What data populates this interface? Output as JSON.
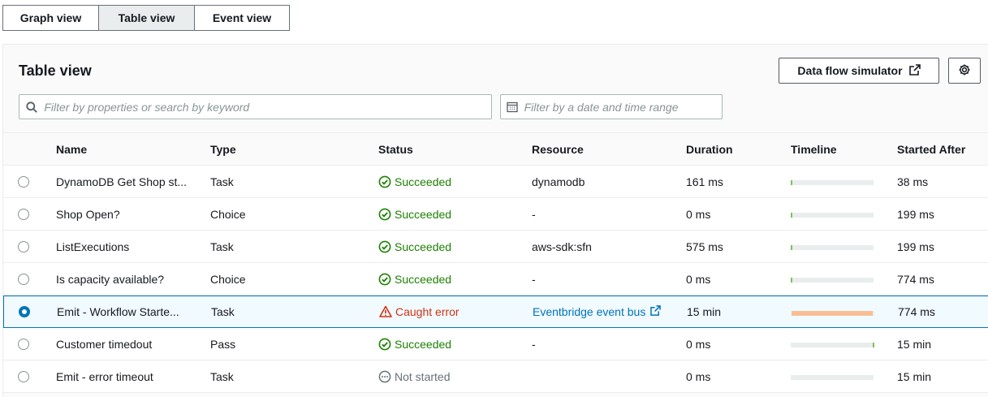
{
  "tabs": [
    {
      "label": "Graph view",
      "active": false
    },
    {
      "label": "Table view",
      "active": true
    },
    {
      "label": "Event view",
      "active": false
    }
  ],
  "panel": {
    "title": "Table view",
    "simulator_label": "Data flow simulator",
    "search_placeholder": "Filter by properties or search by keyword",
    "date_placeholder": "Filter by a date and time range"
  },
  "columns": [
    "Name",
    "Type",
    "Status",
    "Resource",
    "Duration",
    "Timeline",
    "Started After"
  ],
  "rows": [
    {
      "name": "DynamoDB Get Shop st...",
      "type": "Task",
      "status": "Succeeded",
      "status_kind": "ok",
      "resource": "dynamodb",
      "resource_link": false,
      "duration": "161 ms",
      "started_after": "38 ms",
      "selected": false,
      "timeline_start": 0.0,
      "timeline_fill": 0.01
    },
    {
      "name": "Shop Open?",
      "type": "Choice",
      "status": "Succeeded",
      "status_kind": "ok",
      "resource": "-",
      "resource_link": false,
      "duration": "0 ms",
      "started_after": "199 ms",
      "selected": false,
      "timeline_start": 0.0,
      "timeline_fill": 0.01
    },
    {
      "name": "ListExecutions",
      "type": "Task",
      "status": "Succeeded",
      "status_kind": "ok",
      "resource": "aws-sdk:sfn",
      "resource_link": false,
      "duration": "575 ms",
      "started_after": "199 ms",
      "selected": false,
      "timeline_start": 0.0,
      "timeline_fill": 0.01
    },
    {
      "name": "Is capacity available?",
      "type": "Choice",
      "status": "Succeeded",
      "status_kind": "ok",
      "resource": "-",
      "resource_link": false,
      "duration": "0 ms",
      "started_after": "774 ms",
      "selected": false,
      "timeline_start": 0.0,
      "timeline_fill": 0.01
    },
    {
      "name": "Emit - Workflow Starte...",
      "type": "Task",
      "status": "Caught error",
      "status_kind": "err",
      "resource": "Eventbridge event bus",
      "resource_link": true,
      "duration": "15 min",
      "started_after": "774 ms",
      "selected": true,
      "timeline_start": 0.0,
      "timeline_fill": 0.98
    },
    {
      "name": "Customer timedout",
      "type": "Pass",
      "status": "Succeeded",
      "status_kind": "ok",
      "resource": "-",
      "resource_link": false,
      "duration": "0 ms",
      "started_after": "15 min",
      "selected": false,
      "timeline_start": 0.99,
      "timeline_fill": 0.01
    },
    {
      "name": "Emit - error timeout",
      "type": "Task",
      "status": "Not started",
      "status_kind": "ns",
      "resource": "",
      "resource_link": false,
      "duration": "0 ms",
      "started_after": "15 min",
      "selected": false,
      "timeline_start": 0.0,
      "timeline_fill": 0.0
    }
  ],
  "colors": {
    "success": "#1d8102",
    "error": "#d13212",
    "link": "#0073bb",
    "timeline_ok": "#7fbf5a",
    "timeline_err": "#f8bf94"
  }
}
